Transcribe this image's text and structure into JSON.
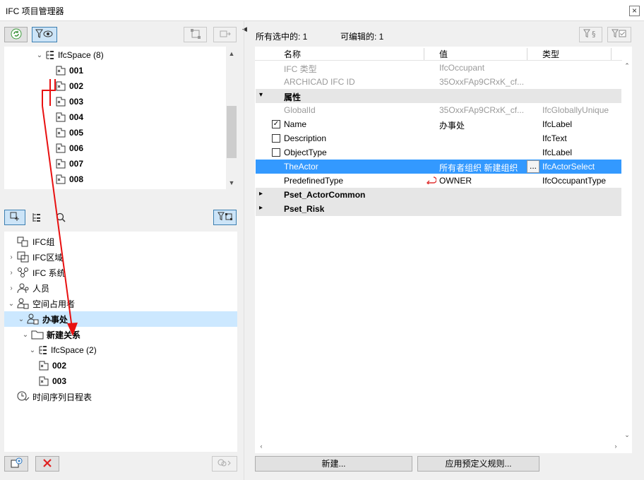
{
  "window": {
    "title": "IFC 项目管理器",
    "close_glyph": "×"
  },
  "top_tree": {
    "rows": [
      {
        "label": "IfcSpace (8)",
        "bold": false
      },
      {
        "label": "001",
        "bold": true
      },
      {
        "label": "002",
        "bold": true
      },
      {
        "label": "003",
        "bold": true
      },
      {
        "label": "004",
        "bold": true
      },
      {
        "label": "005",
        "bold": true
      },
      {
        "label": "006",
        "bold": true
      },
      {
        "label": "007",
        "bold": true
      },
      {
        "label": "008",
        "bold": true
      }
    ]
  },
  "bottom_tree": {
    "rows": [
      {
        "label": "IFC组",
        "expand": ""
      },
      {
        "label": "IFC区域",
        "expand": "›"
      },
      {
        "label": "IFC 系统",
        "expand": "›"
      },
      {
        "label": "人员",
        "expand": "›"
      },
      {
        "label": "空间占用者",
        "expand": "⌄"
      },
      {
        "label": "办事处",
        "expand": "⌄"
      },
      {
        "label": "新建关系",
        "expand": "⌄"
      },
      {
        "label": "IfcSpace (2)",
        "expand": "⌄"
      },
      {
        "label": "002",
        "expand": ""
      },
      {
        "label": "003",
        "expand": ""
      },
      {
        "label": "时间序列日程表",
        "expand": ""
      }
    ]
  },
  "props": {
    "selected_count_label": "所有选中的: 1",
    "editable_count_label": "可编辑的: 1",
    "columns": {
      "name": "名称",
      "value": "值",
      "type": "类型"
    },
    "rows": [
      {
        "kind": "info",
        "name": "IFC 类型",
        "value": "IfcOccupant",
        "type": ""
      },
      {
        "kind": "info",
        "name": "ARCHICAD IFC ID",
        "value": "35OxxFAp9CRxK_cf...",
        "type": ""
      },
      {
        "kind": "section",
        "name": "属性",
        "expanded": "▾"
      },
      {
        "kind": "info",
        "name": "GlobalId",
        "value": "35OxxFAp9CRxK_cf...",
        "type": "IfcGloballyUnique"
      },
      {
        "kind": "attr",
        "checked": "✓",
        "name": "Name",
        "value": "办事处",
        "type": "IfcLabel"
      },
      {
        "kind": "attr",
        "checked": "",
        "name": "Description",
        "value": "",
        "type": "IfcText"
      },
      {
        "kind": "attr",
        "checked": "",
        "name": "ObjectType",
        "value": "",
        "type": "IfcLabel"
      },
      {
        "kind": "selected",
        "name": "TheActor",
        "value": "所有者组织 新建组织",
        "browse": "...",
        "type": "IfcActorSelect"
      },
      {
        "kind": "enum",
        "name": "PredefinedType",
        "value": "OWNER",
        "type": "IfcOccupantType"
      },
      {
        "kind": "section",
        "name": "Pset_ActorCommon",
        "expanded": "▸"
      },
      {
        "kind": "section",
        "name": "Pset_Risk",
        "expanded": "▸"
      }
    ],
    "new_button": "新建...",
    "apply_rules_button": "应用预定义规则..."
  },
  "colors": {
    "selection": "#3399ff",
    "tree_selection": "#cce8ff",
    "arrow": "#e81010"
  }
}
